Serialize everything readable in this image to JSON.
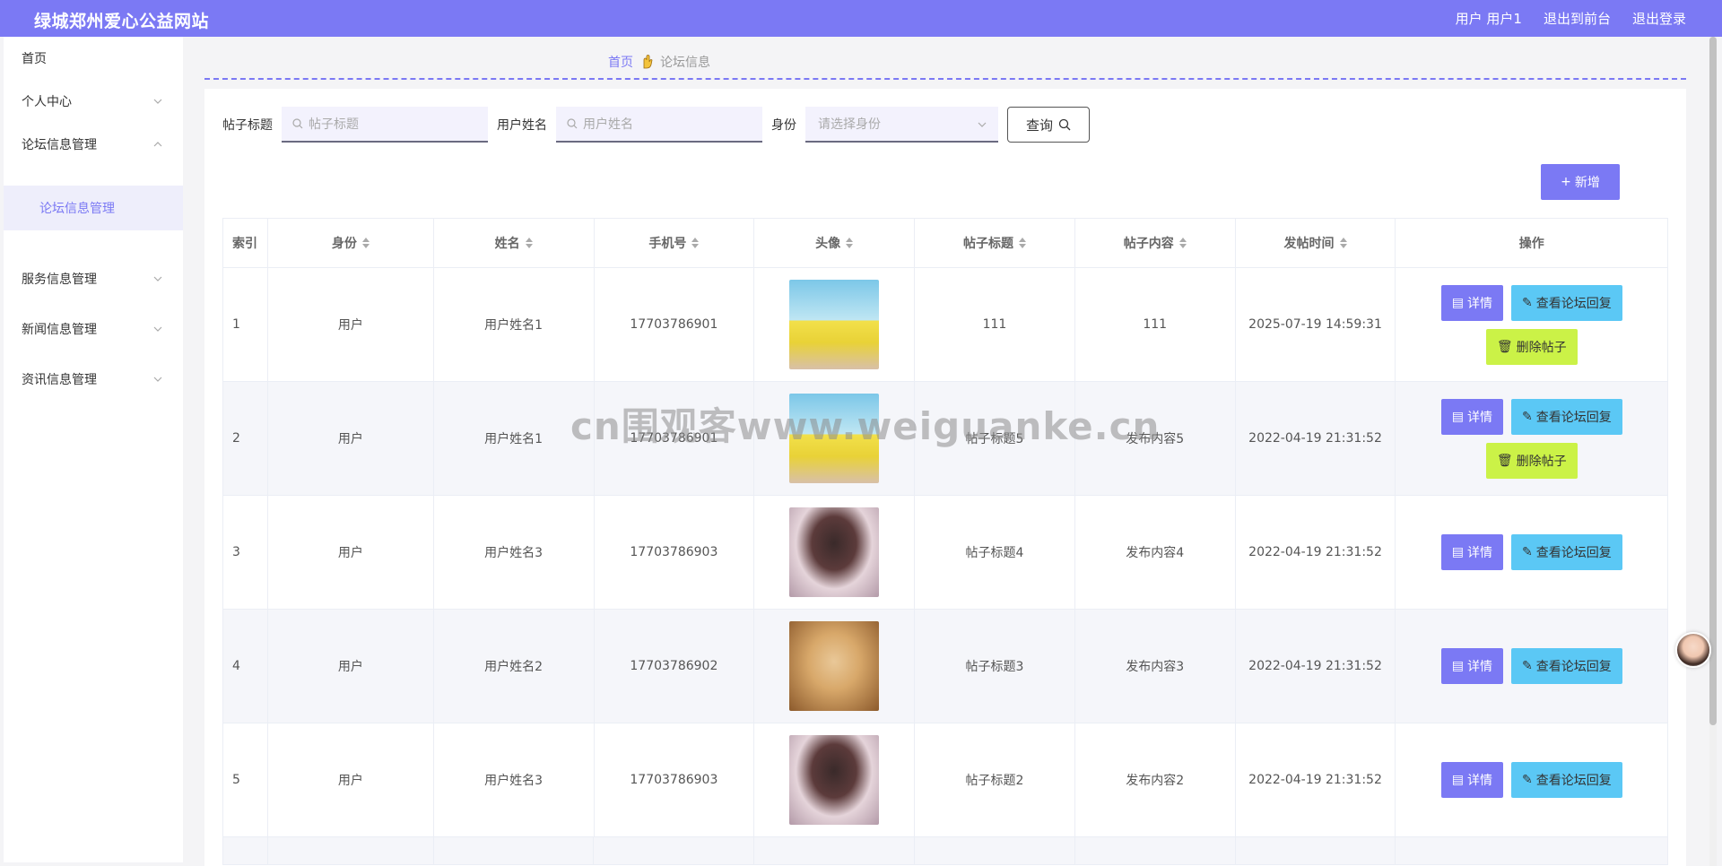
{
  "header": {
    "title": "绿城郑州爱心公益网站",
    "user": "用户 用户1",
    "to_front": "退出到前台",
    "logout": "退出登录"
  },
  "sidebar": {
    "items": [
      {
        "label": "首页"
      },
      {
        "label": "个人中心"
      },
      {
        "label": "论坛信息管理"
      },
      {
        "label": "论坛信息管理"
      },
      {
        "label": "服务信息管理"
      },
      {
        "label": "新闻信息管理"
      },
      {
        "label": "资讯信息管理"
      }
    ]
  },
  "breadcrumb": {
    "home": "首页",
    "current": "论坛信息"
  },
  "search": {
    "title_label": "帖子标题",
    "title_placeholder": "帖子标题",
    "name_label": "用户姓名",
    "name_placeholder": "用户姓名",
    "role_label": "身份",
    "role_placeholder": "请选择身份",
    "query_label": "查询"
  },
  "add_label": "新增",
  "table": {
    "headers": [
      "索引",
      "身份",
      "姓名",
      "手机号",
      "头像",
      "帖子标题",
      "帖子内容",
      "发帖时间",
      "操作"
    ],
    "rows": [
      {
        "index": "1",
        "role": "用户",
        "name": "用户姓名1",
        "phone": "17703786901",
        "title": "111",
        "content": "111",
        "time": "2025-07-19 14:59:31"
      },
      {
        "index": "2",
        "role": "用户",
        "name": "用户姓名1",
        "phone": "17703786901",
        "title": "帖子标题5",
        "content": "发布内容5",
        "time": "2022-04-19 21:31:52"
      },
      {
        "index": "3",
        "role": "用户",
        "name": "用户姓名3",
        "phone": "17703786903",
        "title": "帖子标题4",
        "content": "发布内容4",
        "time": "2022-04-19 21:31:52"
      },
      {
        "index": "4",
        "role": "用户",
        "name": "用户姓名2",
        "phone": "17703786902",
        "title": "帖子标题3",
        "content": "发布内容3",
        "time": "2022-04-19 21:31:52"
      },
      {
        "index": "5",
        "role": "用户",
        "name": "用户姓名3",
        "phone": "17703786903",
        "title": "帖子标题2",
        "content": "发布内容2",
        "time": "2022-04-19 21:31:52"
      }
    ],
    "actions": {
      "detail": "详情",
      "reply": "查看论坛回复",
      "delete": "删除帖子"
    }
  },
  "watermark": "cn围观客www.weiguanke.cn",
  "colors": {
    "primary": "#7b79f4",
    "reply": "#5bc8f5",
    "delete": "#cbf247"
  }
}
